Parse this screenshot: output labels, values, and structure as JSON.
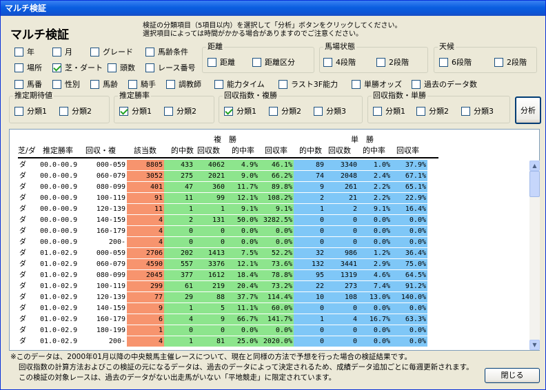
{
  "window": {
    "title": "マルチ検証"
  },
  "heading": "マルチ検証",
  "description": [
    "検証の分類項目（5項目以内）を選択して「分析」ボタンをクリックしてください。",
    "選択項目によっては時間がかかる場合がありますのでご注意ください。"
  ],
  "checkboxes": {
    "nen": "年",
    "tsuki": "月",
    "grade": "グレード",
    "barei": "馬齢条件",
    "basho": "場所",
    "shiba_dirt": "芝・ダート",
    "tosu": "頭数",
    "race_no": "レース番号",
    "umaban": "馬番",
    "seibetsu": "性別",
    "barei2": "馬齢",
    "kishu": "騎手",
    "chokyoshi": "調教師",
    "noryoku_time": "能力タイム",
    "last3f": "ラスト3F能力",
    "tansho_odds": "単勝オッズ",
    "kako_data": "過去のデータ数"
  },
  "groups": {
    "kyori": {
      "title": "距離",
      "a": "距離",
      "b": "距離区分"
    },
    "baba": {
      "title": "馬場状態",
      "a": "4段階",
      "b": "2段階"
    },
    "tenko": {
      "title": "天候",
      "a": "6段階",
      "b": "2段階"
    },
    "kitai": {
      "title": "推定期待値",
      "a": "分類1",
      "b": "分類2"
    },
    "shoritsu": {
      "title": "推定勝率",
      "a": "分類1",
      "b": "分類2"
    },
    "fukusho": {
      "title": "回収指数・複勝",
      "a": "分類1",
      "b": "分類2",
      "c": "分類3"
    },
    "tansho": {
      "title": "回収指数・単勝",
      "a": "分類1",
      "b": "分類2",
      "c": "分類3"
    }
  },
  "buttons": {
    "analyze": "分析",
    "close": "閉じる"
  },
  "table": {
    "group_fuku": "複　勝",
    "group_tan": "単　勝",
    "headers": [
      "芝/ダ",
      "推定勝率",
      "回収・複",
      "該当数",
      "的中数",
      "回収数",
      "的中率",
      "回収率",
      "的中数",
      "回収数",
      "的中率",
      "回収率"
    ],
    "rows": [
      [
        "ダ",
        "00.0-00.9",
        "000-059",
        "8805",
        "433",
        "4062",
        "4.9%",
        "46.1%",
        "89",
        "3340",
        "1.0%",
        "37.9%"
      ],
      [
        "ダ",
        "00.0-00.9",
        "060-079",
        "3052",
        "275",
        "2021",
        "9.0%",
        "66.2%",
        "74",
        "2048",
        "2.4%",
        "67.1%"
      ],
      [
        "ダ",
        "00.0-00.9",
        "080-099",
        "401",
        "47",
        "360",
        "11.7%",
        "89.8%",
        "9",
        "261",
        "2.2%",
        "65.1%"
      ],
      [
        "ダ",
        "00.0-00.9",
        "100-119",
        "91",
        "11",
        "99",
        "12.1%",
        "108.2%",
        "2",
        "21",
        "2.2%",
        "22.9%"
      ],
      [
        "ダ",
        "00.0-00.9",
        "120-139",
        "11",
        "1",
        "1",
        "9.1%",
        "9.1%",
        "1",
        "2",
        "9.1%",
        "16.4%"
      ],
      [
        "ダ",
        "00.0-00.9",
        "140-159",
        "4",
        "2",
        "131",
        "50.0%",
        "3282.5%",
        "0",
        "0",
        "0.0%",
        "0.0%"
      ],
      [
        "ダ",
        "00.0-00.9",
        "160-179",
        "4",
        "0",
        "0",
        "0.0%",
        "0.0%",
        "0",
        "0",
        "0.0%",
        "0.0%"
      ],
      [
        "ダ",
        "00.0-00.9",
        "200-",
        "4",
        "0",
        "0",
        "0.0%",
        "0.0%",
        "0",
        "0",
        "0.0%",
        "0.0%"
      ],
      [
        "ダ",
        "01.0-02.9",
        "000-059",
        "2706",
        "202",
        "1413",
        "7.5%",
        "52.2%",
        "32",
        "986",
        "1.2%",
        "36.4%"
      ],
      [
        "ダ",
        "01.0-02.9",
        "060-079",
        "4590",
        "557",
        "3376",
        "12.1%",
        "73.6%",
        "132",
        "3441",
        "2.9%",
        "75.0%"
      ],
      [
        "ダ",
        "01.0-02.9",
        "080-099",
        "2045",
        "377",
        "1612",
        "18.4%",
        "78.8%",
        "95",
        "1319",
        "4.6%",
        "64.5%"
      ],
      [
        "ダ",
        "01.0-02.9",
        "100-119",
        "299",
        "61",
        "219",
        "20.4%",
        "73.2%",
        "22",
        "273",
        "7.4%",
        "91.2%"
      ],
      [
        "ダ",
        "01.0-02.9",
        "120-139",
        "77",
        "29",
        "88",
        "37.7%",
        "114.4%",
        "10",
        "108",
        "13.0%",
        "140.0%"
      ],
      [
        "ダ",
        "01.0-02.9",
        "140-159",
        "9",
        "1",
        "5",
        "11.1%",
        "60.0%",
        "0",
        "0",
        "0.0%",
        "0.0%"
      ],
      [
        "ダ",
        "01.0-02.9",
        "160-179",
        "6",
        "4",
        "9",
        "66.7%",
        "141.7%",
        "1",
        "4",
        "16.7%",
        "63.3%"
      ],
      [
        "ダ",
        "01.0-02.9",
        "180-199",
        "1",
        "0",
        "0",
        "0.0%",
        "0.0%",
        "0",
        "0",
        "0.0%",
        "0.0%"
      ],
      [
        "ダ",
        "01.0-02.9",
        "200-",
        "4",
        "1",
        "81",
        "25.0%",
        "2020.0%",
        "0",
        "0",
        "0.0%",
        "0.0%"
      ]
    ]
  },
  "notes": [
    "※このデータは、2000年01月以降の中央競馬主催レースについて、現在と同様の方法で予想を行った場合の検証結果です。",
    "回収指数の計算方法およびこの検証の元になるデータは、過去のデータによって決定されるため、成績データ追加ごとに毎週更新されます。",
    "この検証の対象レースは、過去のデータがない出走馬がいない「平地競走」に限定されています。"
  ],
  "colors": {
    "count": "#f7946e",
    "fuku": "#8de58d",
    "tan": "#7fc7f7"
  }
}
